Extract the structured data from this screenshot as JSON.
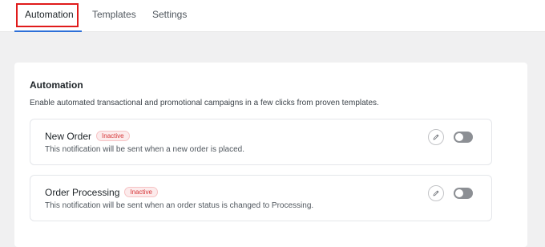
{
  "tabs": [
    {
      "label": "Automation",
      "active": true
    },
    {
      "label": "Templates",
      "active": false
    },
    {
      "label": "Settings",
      "active": false
    }
  ],
  "panel": {
    "title": "Automation",
    "description": "Enable automated transactional and promotional campaigns in a few clicks from proven templates."
  },
  "notifications": [
    {
      "title": "New Order",
      "status": "Inactive",
      "description": "This notification will be sent when a new order is placed.",
      "enabled": false
    },
    {
      "title": "Order Processing",
      "status": "Inactive",
      "description": "This notification will be sent when an order status is changed to Processing.",
      "enabled": false
    }
  ],
  "icons": {
    "edit": "pencil-icon"
  },
  "colors": {
    "accent": "#2c6fd8",
    "highlight": "#e01b1b",
    "inactive_badge": "#d63638",
    "toggle_off": "#8c8f94"
  }
}
